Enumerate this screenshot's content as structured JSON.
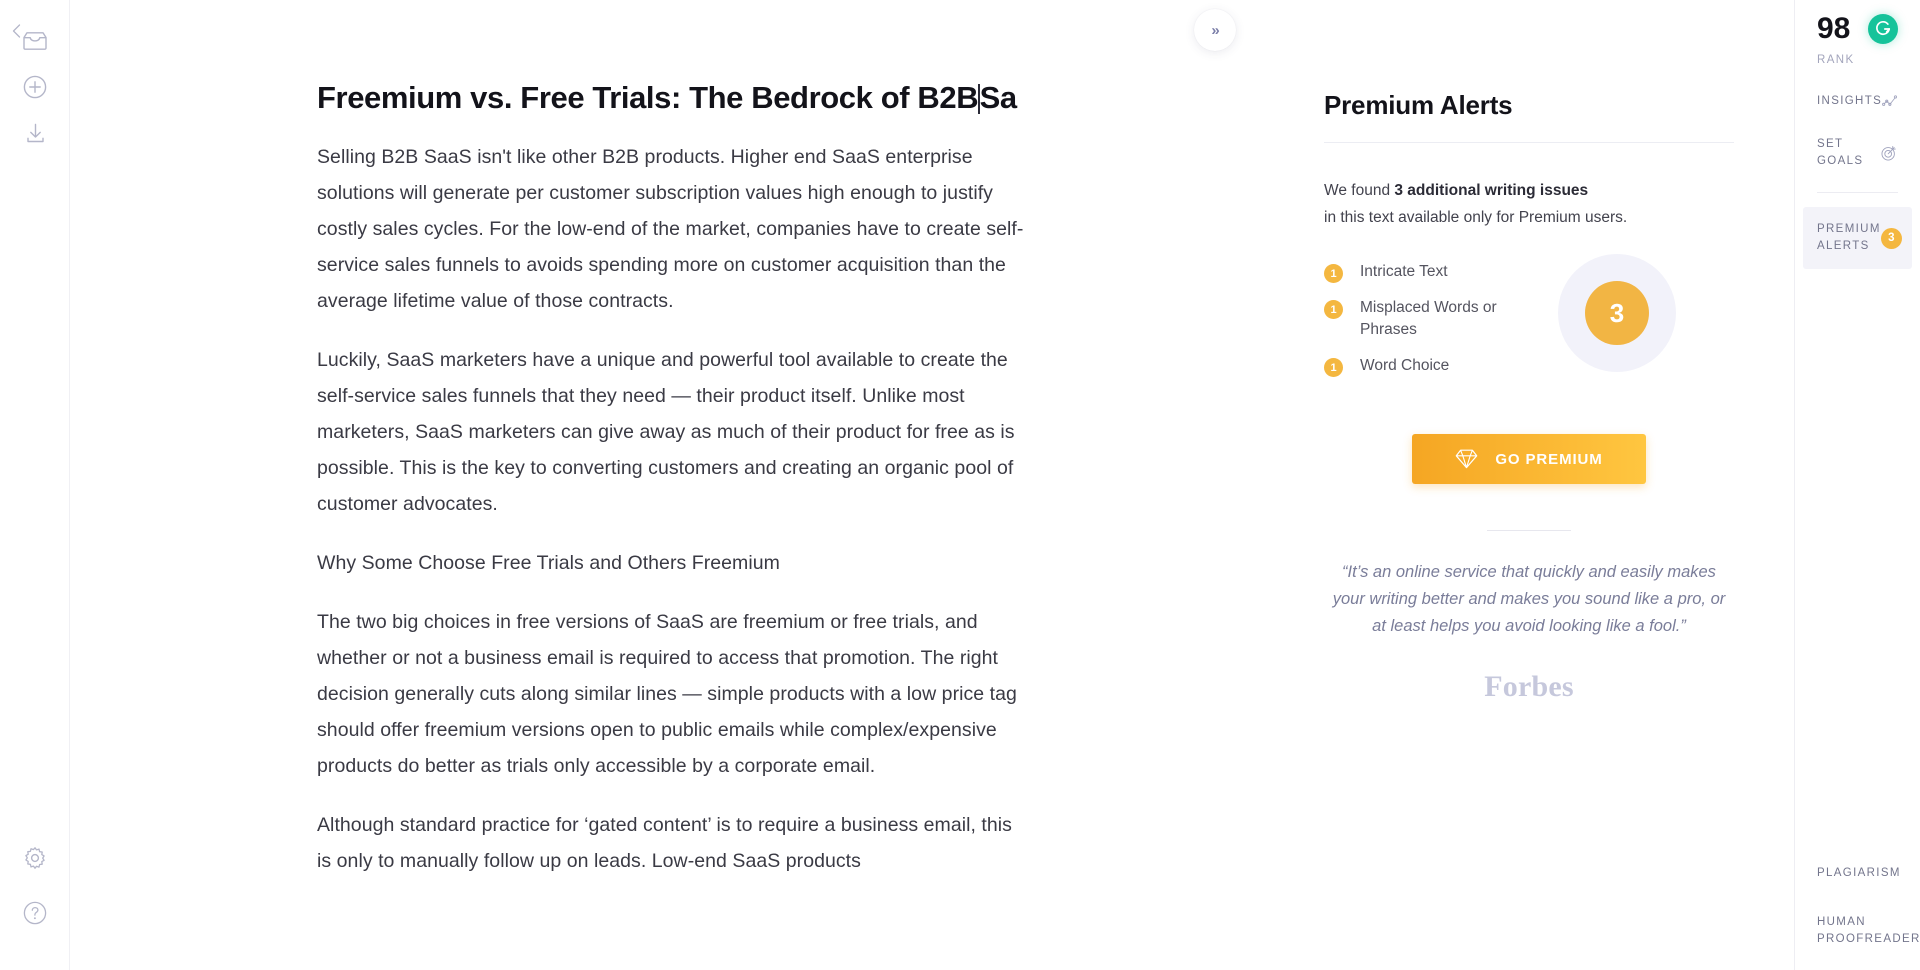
{
  "left_rail": {
    "back_icon": "chevron-left-icon",
    "items": [
      {
        "icon": "inbox-icon",
        "name": "my-grammarly"
      },
      {
        "icon": "plus-circle-icon",
        "name": "new-document"
      },
      {
        "icon": "download-icon",
        "name": "download-document"
      }
    ],
    "bottom_items": [
      {
        "icon": "gear-icon",
        "name": "settings"
      },
      {
        "icon": "question-circle-icon",
        "name": "help"
      }
    ]
  },
  "document": {
    "title_text": "Freemium vs. Free Trials: The Bedrock of B2B",
    "title_tail": "Sa",
    "paragraphs": [
      "Selling B2B SaaS isn't like other B2B products. Higher end SaaS enterprise solutions will generate per customer subscription values high enough to justify costly sales cycles. For the low-end of the market, companies have to create self-service sales funnels to avoids spending more on customer acquisition than the average lifetime value of those contracts.",
      "Luckily, SaaS marketers have a unique and powerful tool available to create the self-service sales funnels that they need — their product itself. Unlike most marketers, SaaS marketers can give away as much of their product for free as is possible. This is the key to converting customers and creating an organic pool of customer advocates.",
      "Why Some Choose Free Trials and Others Freemium",
      "The two big choices in free versions of SaaS are freemium or free trials, and whether or not a business email is required to access that promotion. The right decision generally cuts along similar lines — simple products with a low price tag should offer freemium versions open to public emails while complex/expensive products do better as trials only accessible by a corporate email.",
      "Although standard practice for ‘gated content’ is to require a business email, this is only to manually follow up on leads. Low-end SaaS products"
    ],
    "collapse_button": {
      "glyph": "»",
      "icon": "double-chevron-right-icon"
    }
  },
  "assistant": {
    "title": "Premium Alerts",
    "found_prefix": "We found ",
    "found_strong": "3 additional writing issues",
    "found_suffix": "in this text available only for Premium users.",
    "alerts": [
      {
        "count": "1",
        "label": "Intricate Text"
      },
      {
        "count": "1",
        "label": "Misplaced Words or Phrases"
      },
      {
        "count": "1",
        "label": "Word Choice"
      }
    ],
    "donut_value": "3",
    "cta": {
      "label": "GO PREMIUM",
      "icon": "diamond-icon"
    },
    "quote": "“It’s an online service that quickly and easily makes your writing better and makes you sound like a pro, or at least helps you avoid looking like a fool.”",
    "quote_source": "Forbes"
  },
  "right_rail": {
    "score": "98",
    "score_label": "RANK",
    "logo_icon": "grammarly-g-icon",
    "items": [
      {
        "label": "INSIGHTS",
        "icon": "line-chart-icon",
        "name": "insights"
      },
      {
        "label": "SET GOALS",
        "icon": "target-icon",
        "name": "set-goals"
      }
    ],
    "active_item": {
      "label": "PREMIUM ALERTS",
      "count": "3",
      "name": "premium-alerts"
    },
    "bottom_items": [
      {
        "label": "PLAGIARISM",
        "icon": "quote-marks-icon",
        "name": "plagiarism"
      },
      {
        "label": "HUMAN PROOFREADER",
        "icon": "person-check-icon",
        "name": "human-proofreader"
      }
    ]
  },
  "colors": {
    "brand_green": "#15C39A",
    "alert_orange": "#F4B740",
    "cta_gradient_from": "#F5A623",
    "cta_gradient_to": "#FFC640",
    "panel_active_bg": "#F3F3F9",
    "donut_ring": "#F2F2FA",
    "text_dark": "#13131A",
    "text_body": "#3A3A44",
    "label_muted": "#73758C"
  }
}
